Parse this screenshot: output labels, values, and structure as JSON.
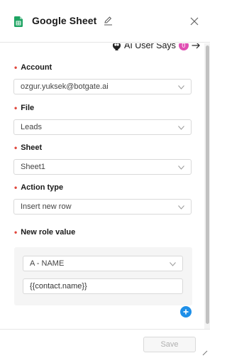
{
  "header": {
    "title": "Google Sheet",
    "icon": "google-sheets-icon"
  },
  "ai_user_says": {
    "label": "AI User Says",
    "badge": "0"
  },
  "fields": {
    "account": {
      "label": "Account",
      "value": "ozgur.yuksek@botgate.ai",
      "required": true
    },
    "file": {
      "label": "File",
      "value": "Leads",
      "required": true
    },
    "sheet": {
      "label": "Sheet",
      "value": "Sheet1",
      "required": true
    },
    "action_type": {
      "label": "Action type",
      "value": "Insert new row",
      "required": true
    },
    "new_role_value": {
      "label": "New role value",
      "required": true,
      "column_value": "A - NAME",
      "input_value": "{{contact.name}}"
    }
  },
  "footer": {
    "save_label": "Save"
  },
  "colors": {
    "sheets_green": "#1fa463",
    "required_red": "#e0463c",
    "badge_pink": "#e04fb3",
    "add_blue": "#1e8fe8"
  }
}
